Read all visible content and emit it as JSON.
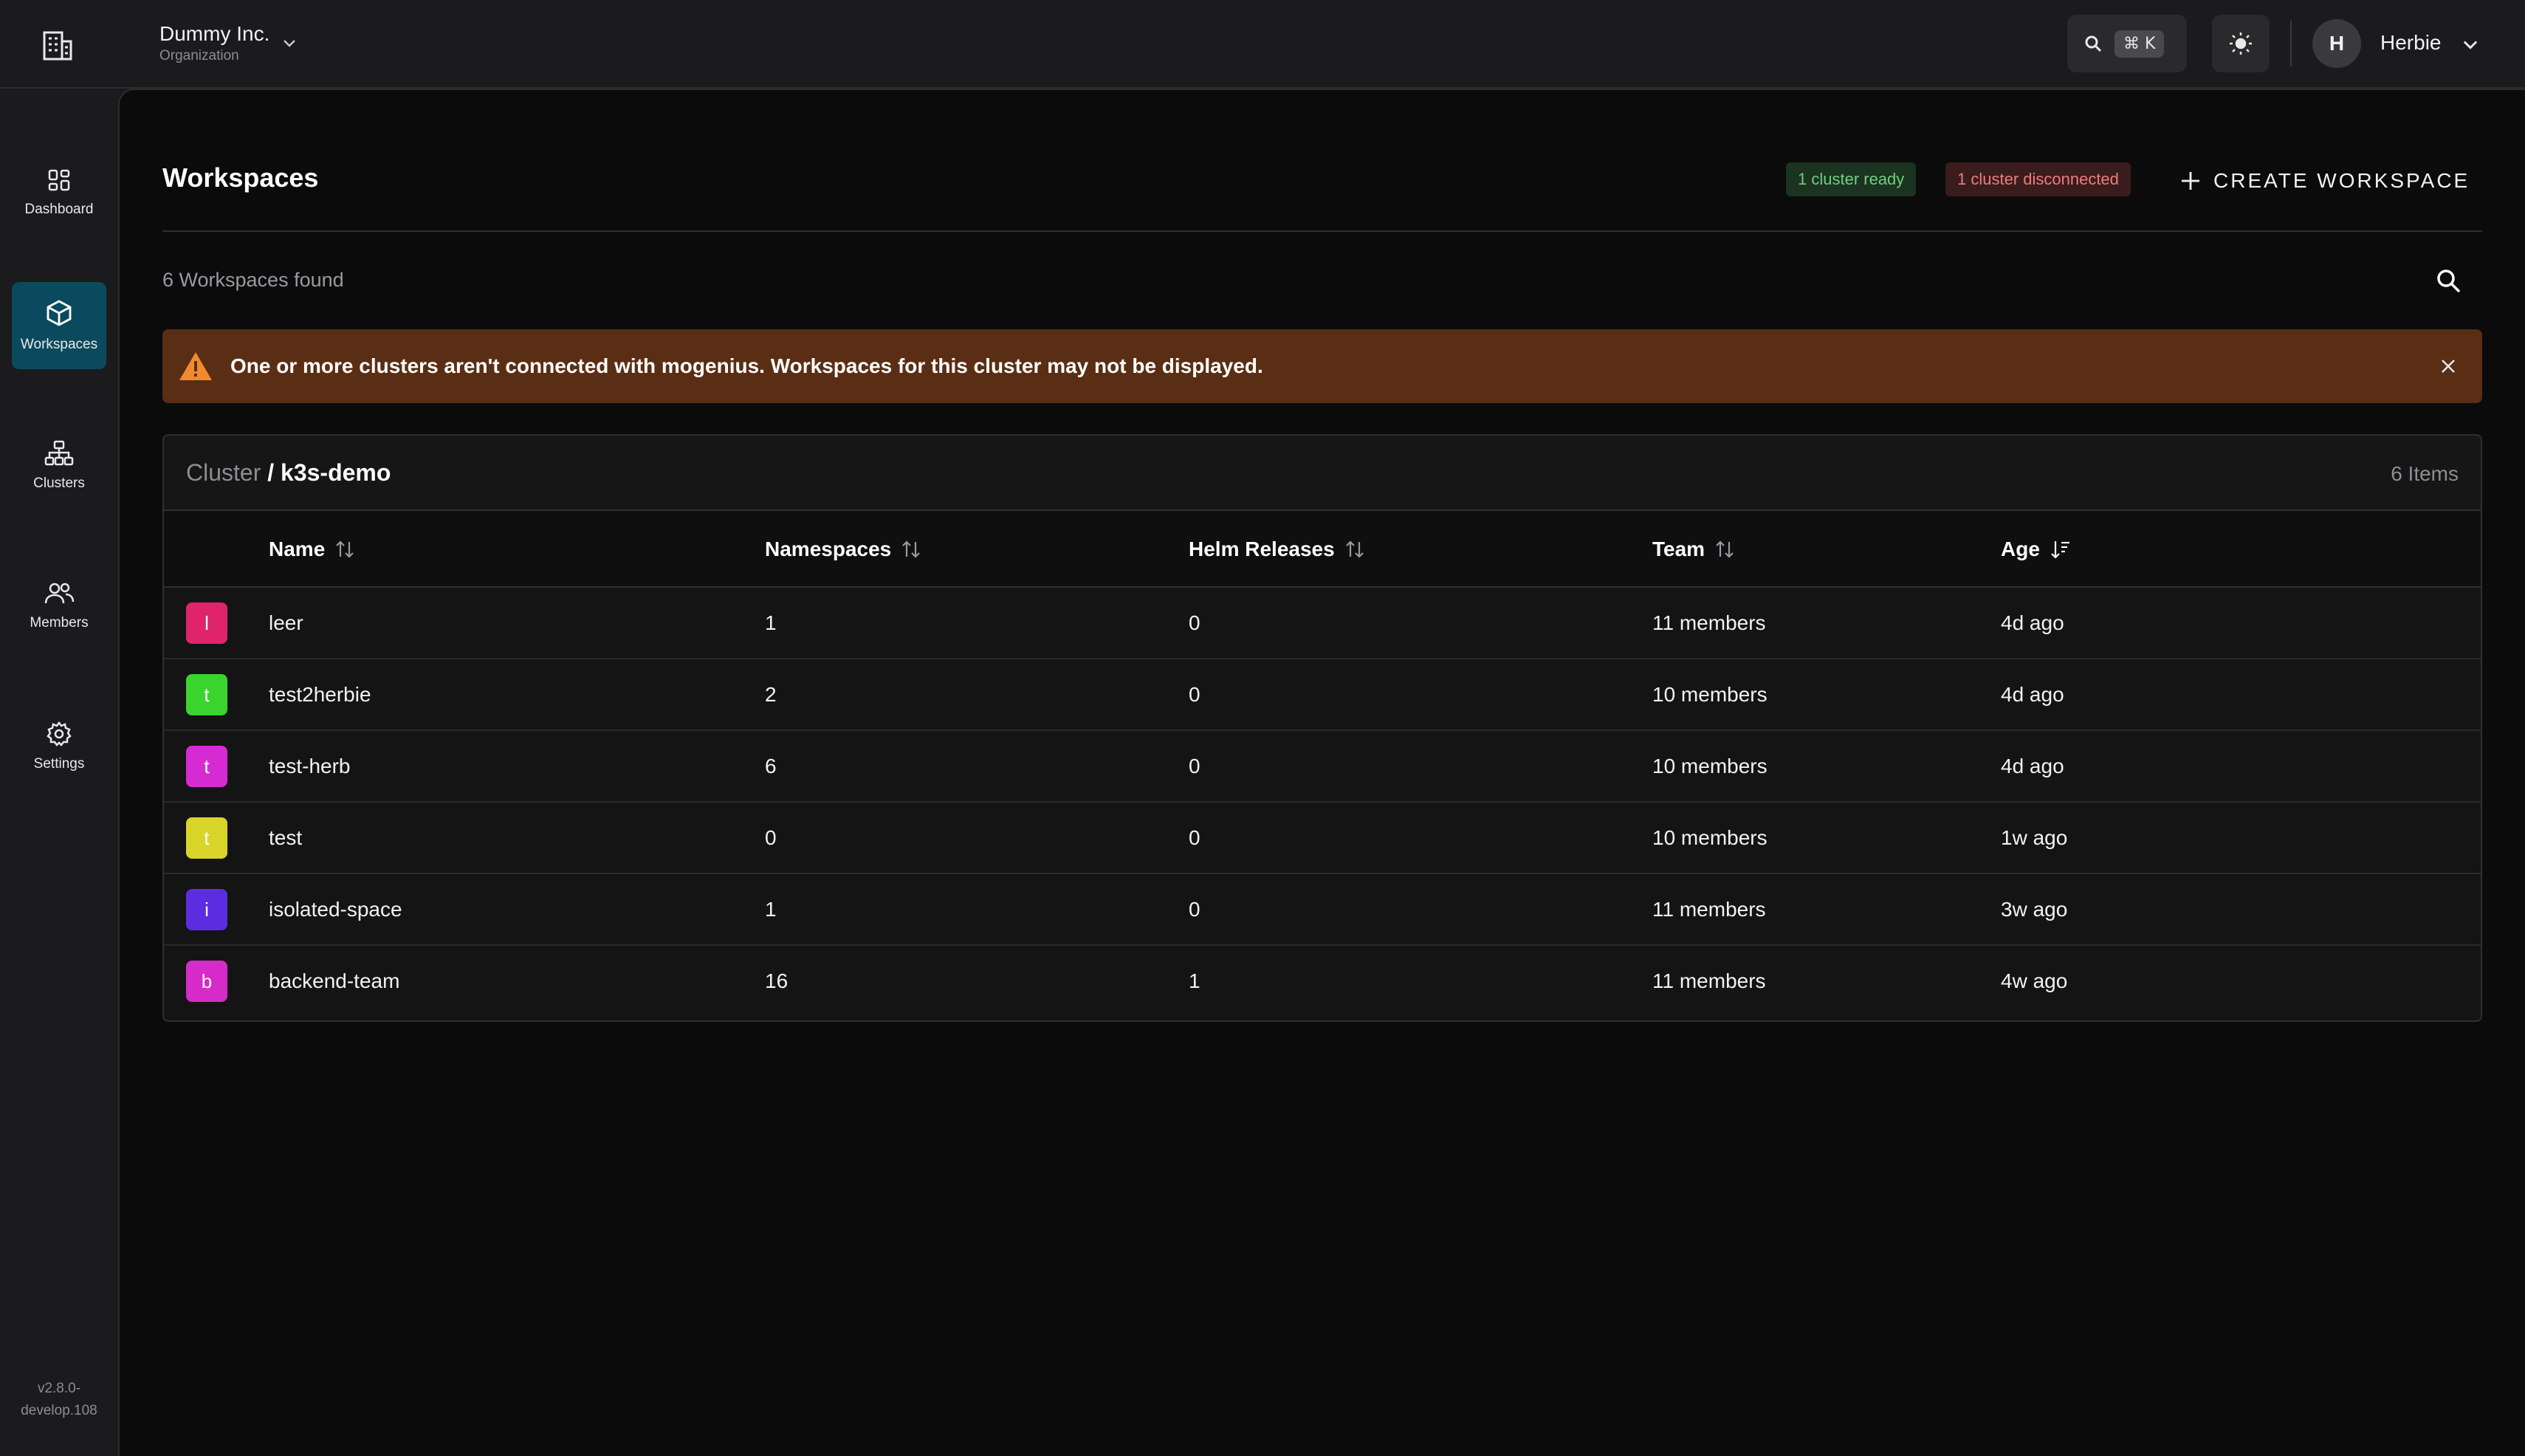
{
  "org": {
    "name": "Dummy Inc.",
    "subtitle": "Organization"
  },
  "topbar": {
    "shortcut": "⌘ K",
    "user_initial": "H",
    "user_name": "Herbie"
  },
  "sidebar": {
    "items": [
      {
        "label": "Dashboard",
        "icon": "dashboard-icon"
      },
      {
        "label": "Workspaces",
        "icon": "cube-icon",
        "active": true
      },
      {
        "label": "Clusters",
        "icon": "cluster-icon"
      },
      {
        "label": "Members",
        "icon": "members-icon"
      },
      {
        "label": "Settings",
        "icon": "gear-icon"
      }
    ],
    "version_line1": "v2.8.0-",
    "version_line2": "develop.108"
  },
  "page": {
    "title": "Workspaces",
    "badge_ready": "1 cluster ready",
    "badge_disconnected": "1 cluster disconnected",
    "create_label": "CREATE WORKSPACE",
    "found_text": "6 Workspaces found"
  },
  "alert": {
    "text": "One or more clusters aren't connected with mogenius. Workspaces for this cluster may not be displayed."
  },
  "card": {
    "crumb_prefix": "Cluster",
    "crumb_sep": " / ",
    "cluster_name": "k3s-demo",
    "items_count": "6 Items"
  },
  "table": {
    "headers": [
      "Name",
      "Namespaces",
      "Helm Releases",
      "Team",
      "Age"
    ],
    "rows": [
      {
        "initial": "l",
        "color": "#e0246b",
        "name": "leer",
        "namespaces": "1",
        "helm": "0",
        "team": "11 members",
        "age": "4d ago"
      },
      {
        "initial": "t",
        "color": "#39d42e",
        "name": "test2herbie",
        "namespaces": "2",
        "helm": "0",
        "team": "10 members",
        "age": "4d ago"
      },
      {
        "initial": "t",
        "color": "#d62bd2",
        "name": "test-herb",
        "namespaces": "6",
        "helm": "0",
        "team": "10 members",
        "age": "4d ago"
      },
      {
        "initial": "t",
        "color": "#d9d428",
        "name": "test",
        "namespaces": "0",
        "helm": "0",
        "team": "10 members",
        "age": "1w ago"
      },
      {
        "initial": "i",
        "color": "#5a2ee0",
        "name": "isolated-space",
        "namespaces": "1",
        "helm": "0",
        "team": "11 members",
        "age": "3w ago"
      },
      {
        "initial": "b",
        "color": "#d62bc9",
        "name": "backend-team",
        "namespaces": "16",
        "helm": "1",
        "team": "11 members",
        "age": "4w ago"
      }
    ]
  },
  "colors": {
    "accent_active_nav": "#0b4a5e",
    "alert_bg": "#5a2e15",
    "badge_ready": "#6fcf7f",
    "badge_disconnected": "#ee7c7c"
  }
}
